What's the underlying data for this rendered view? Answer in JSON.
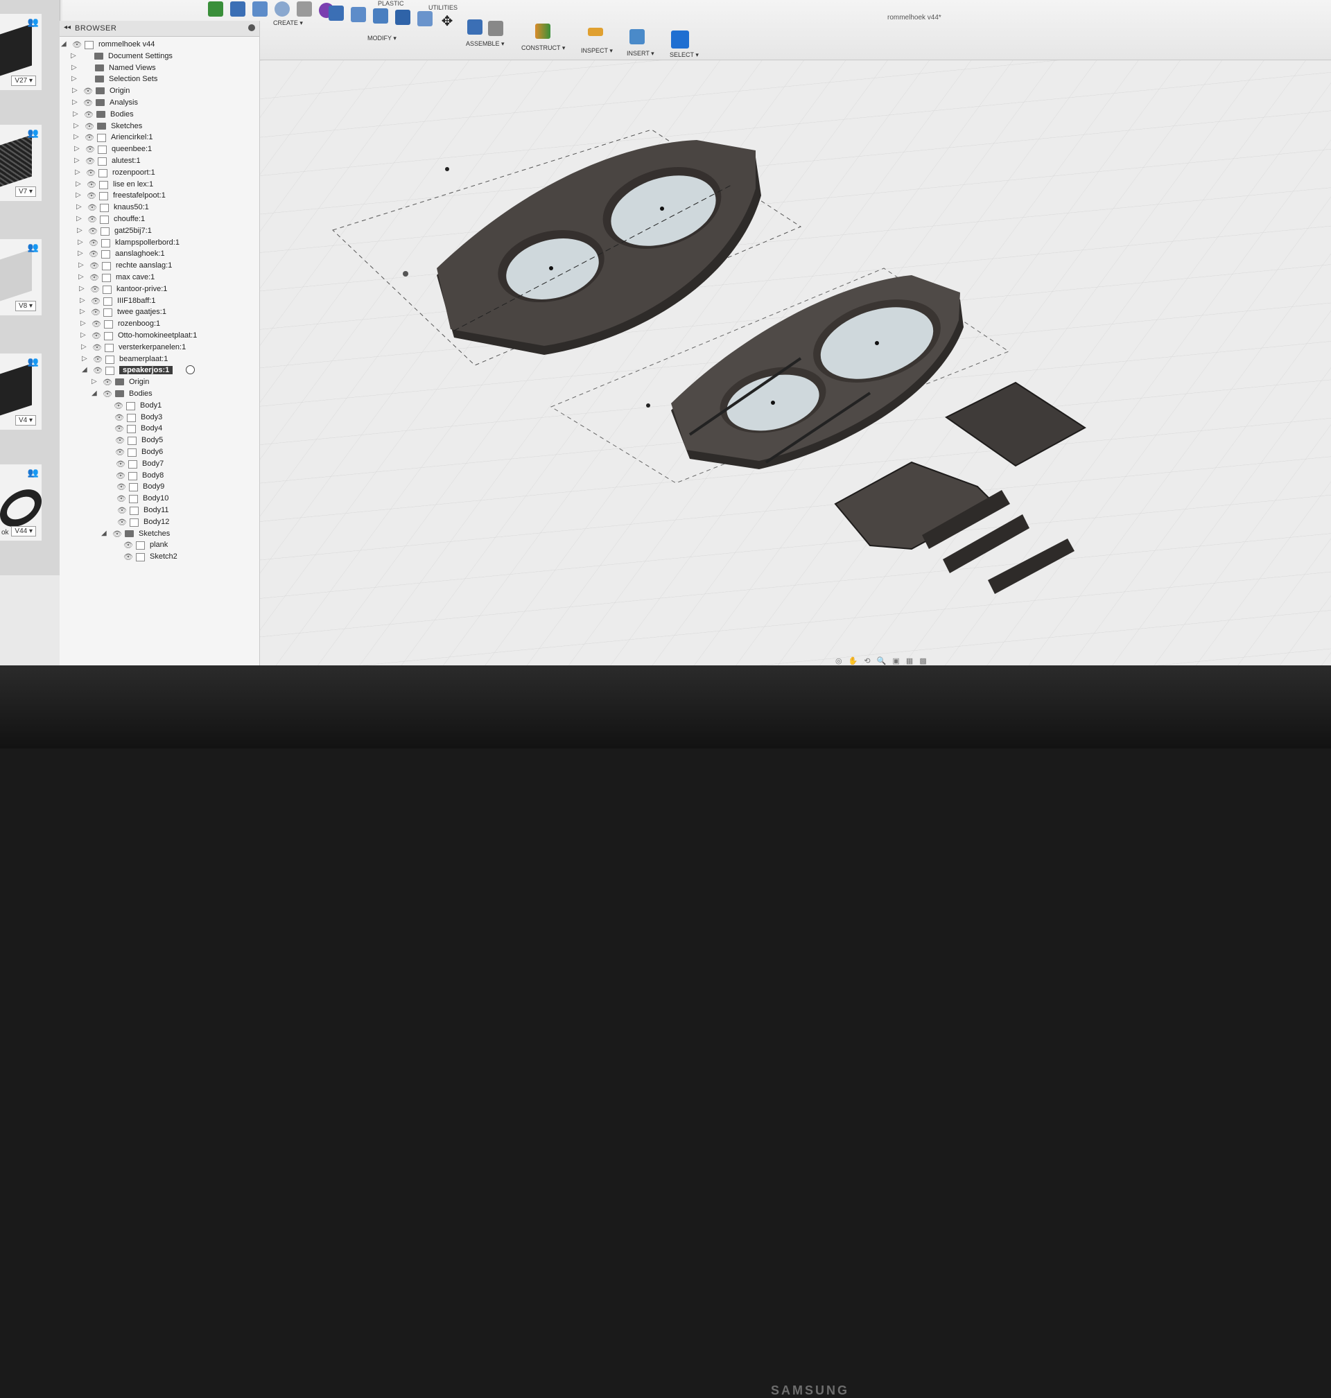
{
  "document": {
    "title": "rommelhoek v44*"
  },
  "toolbar": {
    "tabs": [
      "PLASTIC",
      "UTILITIES"
    ],
    "groups": [
      {
        "label": "CREATE ▾"
      },
      {
        "label": "MODIFY ▾"
      },
      {
        "label": "ASSEMBLE ▾"
      },
      {
        "label": "CONSTRUCT ▾"
      },
      {
        "label": "INSPECT ▾"
      },
      {
        "label": "INSERT ▾"
      },
      {
        "label": "SELECT ▾"
      }
    ]
  },
  "data_panel": {
    "versions": [
      "V27 ▾",
      "V7 ▾",
      "V8 ▾",
      "V4 ▾",
      "V44 ▾"
    ],
    "partial_label": "ok"
  },
  "browser": {
    "title": "BROWSER",
    "root": "rommelhoek v44",
    "items": [
      "Document Settings",
      "Named Views",
      "Selection Sets",
      "Origin",
      "Analysis",
      "Bodies",
      "Sketches",
      "Ariencirkel:1",
      "queenbee:1",
      "alutest:1",
      "rozenpoort:1",
      "lise en lex:1",
      "freestafelpoot:1",
      "knaus50:1",
      "chouffe:1",
      "gat25bij7:1",
      "klampspollerbord:1",
      "aanslaghoek:1",
      "rechte aanslag:1",
      "max cave:1",
      "kantoor-prive:1",
      "IIIF18baff:1",
      "twee gaatjes:1",
      "rozenboog:1",
      "Otto-homokineetplaat:1",
      "versterkerpanelen:1",
      "beamerplaat:1"
    ],
    "active_component": "speakerjos:1",
    "active_children": {
      "origin": "Origin",
      "bodies": "Bodies",
      "body_list": [
        "Body1",
        "Body3",
        "Body4",
        "Body5",
        "Body6",
        "Body7",
        "Body8",
        "Body9",
        "Body10",
        "Body11",
        "Body12"
      ],
      "sketches": "Sketches",
      "sketch_list": [
        "plank",
        "Sketch2"
      ]
    }
  },
  "monitor": {
    "brand": "SAMSUNG"
  },
  "colors": {
    "body_fill": "#4a4542",
    "body_dark": "#2e2b29",
    "hole_fill": "#cfd8dc",
    "grid": "#d2d2d2",
    "active_row": "#3d3d3d"
  }
}
